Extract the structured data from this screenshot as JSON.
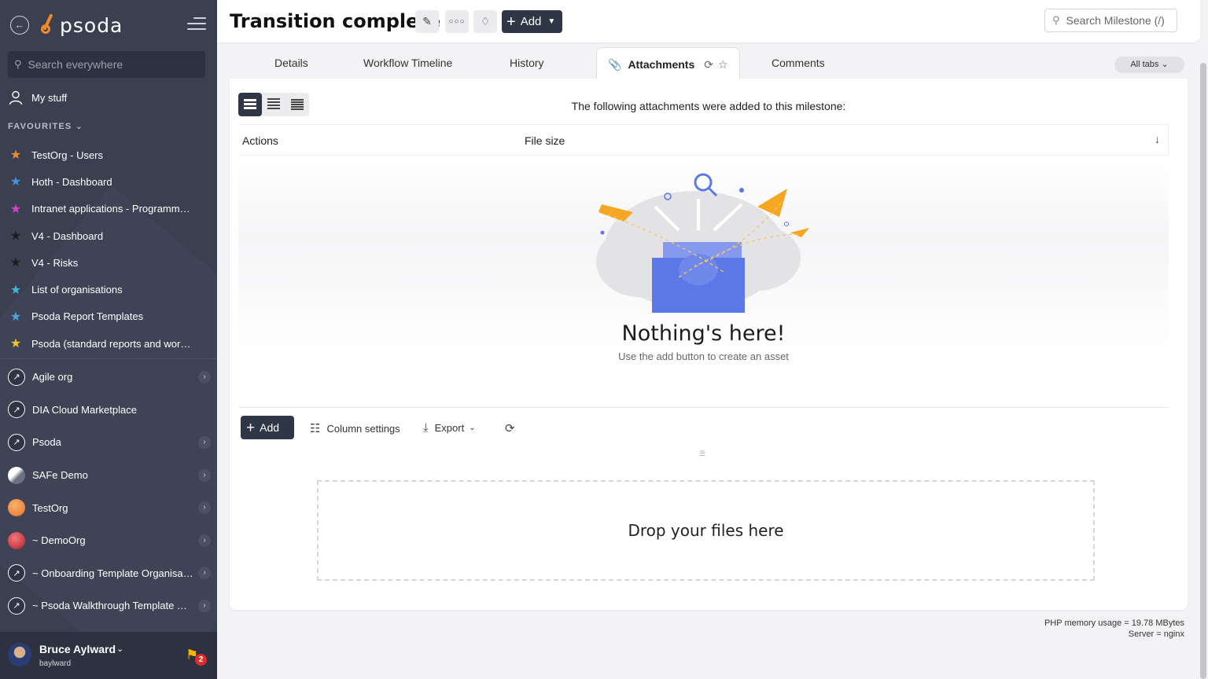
{
  "app": {
    "logo_text": "psoda"
  },
  "sidebar": {
    "search_placeholder": "Search everywhere",
    "my_stuff": "My stuff",
    "favourites_heading": "FAVOURITES",
    "favourites": [
      {
        "label": "TestOrg - Users",
        "color": "#f28a2d"
      },
      {
        "label": "Hoth - Dashboard",
        "color": "#4a90e2"
      },
      {
        "label": "Intranet applications - Programme…",
        "color": "#d63fc9"
      },
      {
        "label": "V4 - Dashboard",
        "color": "#1c1c1c"
      },
      {
        "label": "V4 - Risks",
        "color": "#1c1c1c"
      },
      {
        "label": "List of organisations",
        "color": "#3fb6d6"
      },
      {
        "label": "Psoda Report Templates",
        "color": "#4aa3df"
      },
      {
        "label": "Psoda (standard reports and work…",
        "color": "#f2c12d"
      }
    ],
    "orgs": [
      {
        "label": "Agile org",
        "avatar": "rocket",
        "chevron": true
      },
      {
        "label": "DIA Cloud Marketplace",
        "avatar": "rocket",
        "chevron": false
      },
      {
        "label": "Psoda",
        "avatar": "rocket",
        "chevron": true
      },
      {
        "label": "SAFe Demo",
        "avatar": "safe",
        "chevron": true
      },
      {
        "label": "TestOrg",
        "avatar": "test",
        "chevron": true
      },
      {
        "label": "~ DemoOrg",
        "avatar": "demo",
        "chevron": true
      },
      {
        "label": "~ Onboarding Template Organisa…",
        "avatar": "rocket",
        "chevron": true
      },
      {
        "label": "~ Psoda Walkthrough Template P…",
        "avatar": "rocket",
        "chevron": true
      }
    ],
    "user": {
      "name": "Bruce Aylward",
      "handle": "baylward",
      "notifications": "2"
    }
  },
  "header": {
    "title": "Transition complete",
    "add_label": "Add",
    "search_placeholder": "Search Milestone (/)"
  },
  "tabs": {
    "items": [
      "Details",
      "Workflow Timeline",
      "History",
      "Attachments",
      "Comments"
    ],
    "active": "Attachments",
    "all_tabs": "All tabs"
  },
  "attachments": {
    "description": "The following attachments were added to this milestone:",
    "columns": [
      "Actions",
      "File size"
    ],
    "empty_title": "Nothing's here!",
    "empty_subtitle": "Use the add button to create an asset",
    "toolbar": {
      "add_label": "Add",
      "column_settings": "Column settings",
      "export": "Export"
    },
    "dropzone": "Drop your files here"
  },
  "footer": {
    "memory": "PHP memory usage = 19.78 MBytes",
    "server": "Server = nginx"
  }
}
